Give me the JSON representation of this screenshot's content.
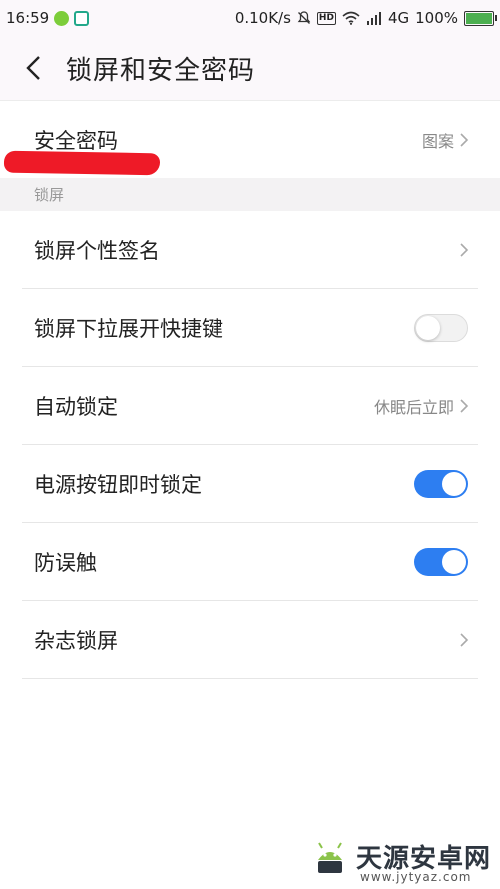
{
  "status_bar": {
    "time": "16:59",
    "speed": "0.10K/s",
    "hd": "HD",
    "network": "4G",
    "battery": "100%"
  },
  "header": {
    "title": "锁屏和安全密码"
  },
  "security_password": {
    "label": "安全密码",
    "value": "图案"
  },
  "section": {
    "lock_screen": "锁屏"
  },
  "items": [
    {
      "label": "锁屏个性签名",
      "type": "link",
      "value": ""
    },
    {
      "label": "锁屏下拉展开快捷键",
      "type": "toggle",
      "on": false
    },
    {
      "label": "自动锁定",
      "type": "link",
      "value": "休眠后立即"
    },
    {
      "label": "电源按钮即时锁定",
      "type": "toggle",
      "on": true
    },
    {
      "label": "防误触",
      "type": "toggle",
      "on": true
    },
    {
      "label": "杂志锁屏",
      "type": "link",
      "value": ""
    }
  ],
  "colors": {
    "accent": "#2d7ef1",
    "annotation": "#ee1a27"
  },
  "watermark": {
    "name": "天源安卓网",
    "url": "www.jytyaz.com"
  }
}
